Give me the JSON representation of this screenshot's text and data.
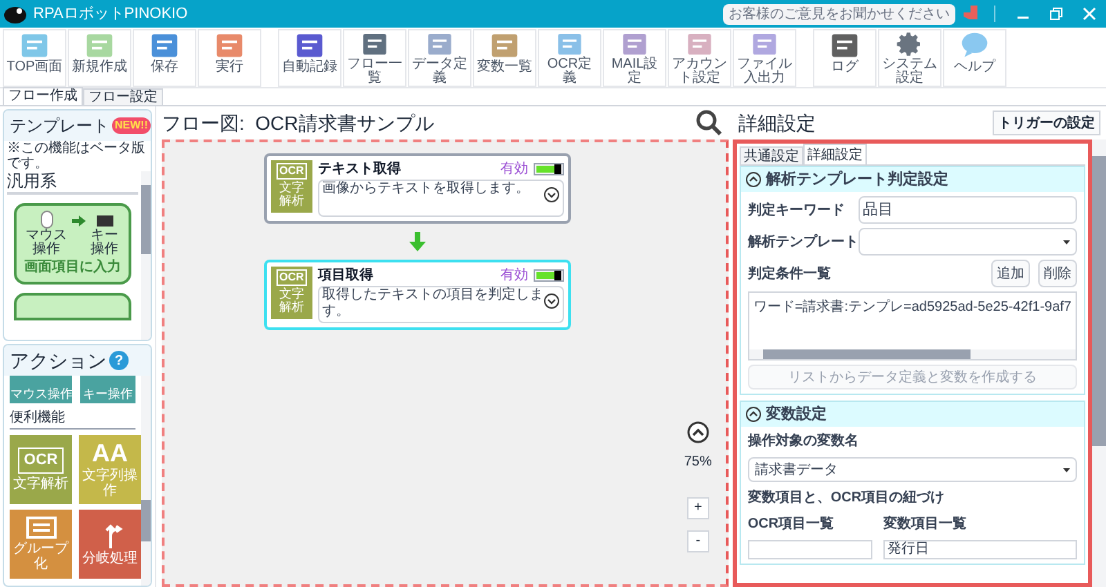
{
  "window": {
    "title": "RPAロボットPINOKIO",
    "feedback": "お客様のご意見をお聞かせください"
  },
  "toolbar": [
    {
      "label": "TOP画面"
    },
    {
      "label": "新規作成"
    },
    {
      "label": "保存"
    },
    {
      "label": "実行"
    },
    {
      "label": "自動記録"
    },
    {
      "label": "フロー一覧"
    },
    {
      "label": "データ定義"
    },
    {
      "label": "変数一覧"
    },
    {
      "label": "OCR定義"
    },
    {
      "label": "MAIL設定"
    },
    {
      "label": "アカウント設定"
    },
    {
      "label": "ファイル入出力"
    },
    {
      "label": "ログ"
    },
    {
      "label": "システム設定"
    },
    {
      "label": "ヘルプ"
    }
  ],
  "tabs": [
    {
      "label": "フロー作成",
      "selected": true
    },
    {
      "label": "フロー設定",
      "selected": false
    }
  ],
  "template_panel": {
    "title": "テンプレート",
    "badge": "NEW!!",
    "note": "※この機能はベータ版です。",
    "section": "汎用系",
    "card": {
      "from_label": "マウス操作",
      "to_label": "キー操作",
      "title": "画面項目に入力"
    }
  },
  "action_panel": {
    "title": "アクション",
    "help": "?",
    "top_tiles": [
      {
        "label": "マウス操作",
        "color": "#4aa3a0"
      },
      {
        "label": "キー操作",
        "color": "#4aa3a0"
      }
    ],
    "section": "便利機能",
    "tiles": [
      {
        "kind": "ocr",
        "glyph": "OCR",
        "label": "文字解析",
        "color": "#9aa84a"
      },
      {
        "kind": "text",
        "glyph": "AA",
        "label": "文字列操作",
        "color": "#c4b84a"
      },
      {
        "kind": "group",
        "label": "グループ化",
        "color": "#d49040"
      },
      {
        "kind": "branch",
        "label": "分岐処理",
        "color": "#d0604a"
      }
    ]
  },
  "flow": {
    "title": "フロー図:  OCR請求書サンプル",
    "nodes": [
      {
        "title": "テキスト取得",
        "description": "画像からテキストを取得します。",
        "icon_text": "OCR",
        "icon_label": "文字解析",
        "status": "有効",
        "on": true,
        "selected": false
      },
      {
        "title": "項目取得",
        "description": "取得したテキストの項目を判定します。",
        "icon_text": "OCR",
        "icon_label": "文字解析",
        "status": "有効",
        "on": true,
        "selected": true
      }
    ],
    "zoom": "75%",
    "zoom_in": "+",
    "zoom_out": "-"
  },
  "details": {
    "title": "詳細設定",
    "trigger_button": "トリガーの設定",
    "tabs": [
      {
        "label": "共通設定",
        "selected": false
      },
      {
        "label": "詳細設定",
        "selected": true
      }
    ],
    "section1": {
      "title": "解析テンプレート判定設定",
      "expanded": true,
      "keyword_label": "判定キーワード",
      "keyword_value": "品目",
      "template_label": "解析テンプレート",
      "list_label": "判定条件一覧",
      "add_button": "追加",
      "delete_button": "削除",
      "conditions": [
        "ワード=請求書:テンプレ=ad5925ad-5e25-42f1-9af7"
      ],
      "create_button": "リストからデータ定義と変数を作成する"
    },
    "section2": {
      "title": "変数設定",
      "expanded": true,
      "var_label": "操作対象の変数名",
      "var_value": "請求書データ",
      "mapping_label": "変数項目と、OCR項目の紐づけ",
      "ocr_list_label": "OCR項目一覧",
      "var_list_label": "変数項目一覧",
      "var_list_first": "発行日"
    }
  }
}
